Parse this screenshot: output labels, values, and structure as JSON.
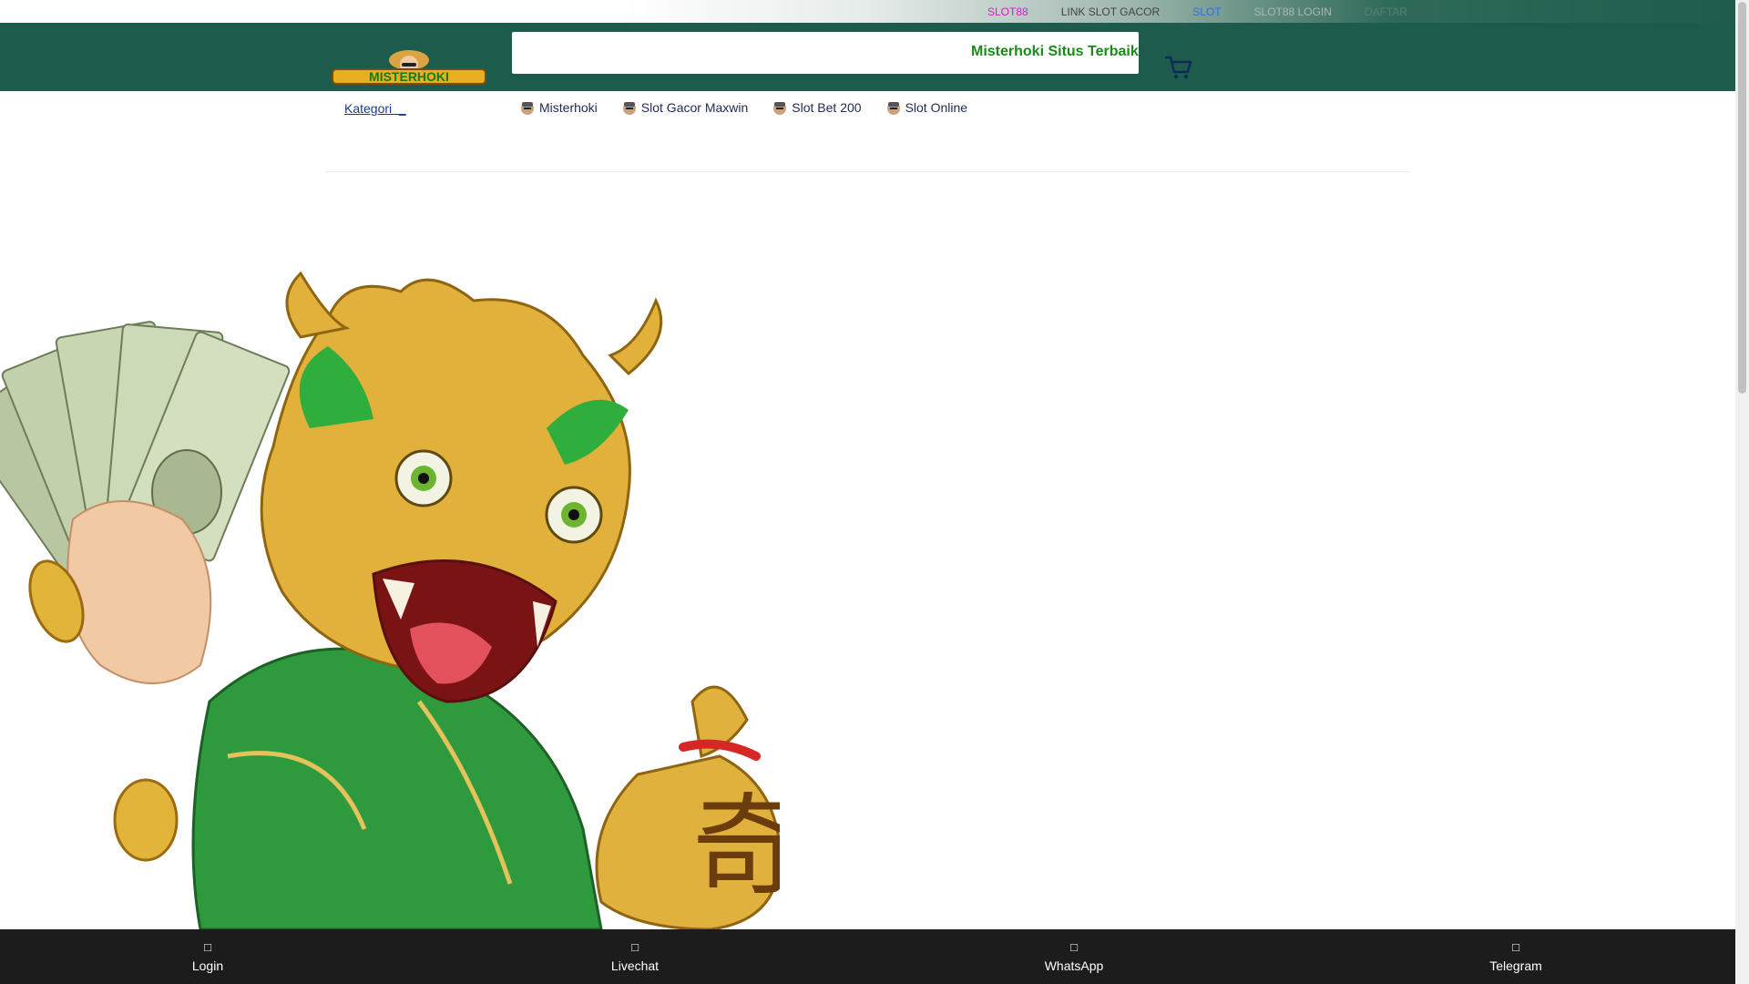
{
  "top_links": [
    {
      "label": "SLOT88",
      "color": "#d61ec5"
    },
    {
      "label": "LINK SLOT GACOR",
      "color": "#444444"
    },
    {
      "label": "SLOT",
      "color": "#2f6fe0"
    },
    {
      "label": "SLOT88 LOGIN",
      "color": "#a9b9b3"
    },
    {
      "label": "DAFTAR",
      "color": "#567f73"
    }
  ],
  "header": {
    "logo_text": "MISTERHOKI",
    "marquee_text": "Misterhoki Situs Terbaik D"
  },
  "nav": {
    "kategori_label": "Kategori  _",
    "items": [
      {
        "label": "Misterhoki"
      },
      {
        "label": "Slot Gacor Maxwin"
      },
      {
        "label": "Slot Bet 200"
      },
      {
        "label": "Slot Online"
      }
    ]
  },
  "bottom_bar": {
    "items": [
      {
        "label": "Login",
        "icon": "login-icon"
      },
      {
        "label": "Livechat",
        "icon": "livechat-icon"
      },
      {
        "label": "WhatsApp",
        "icon": "whatsapp-icon"
      },
      {
        "label": "Telegram",
        "icon": "telegram-icon"
      }
    ]
  },
  "colors": {
    "header_bg": "#1d5c4c",
    "marquee": "#1a8a1a",
    "bottom_bar_bg": "#1c1c1c",
    "nav_text": "#1e2a55"
  }
}
